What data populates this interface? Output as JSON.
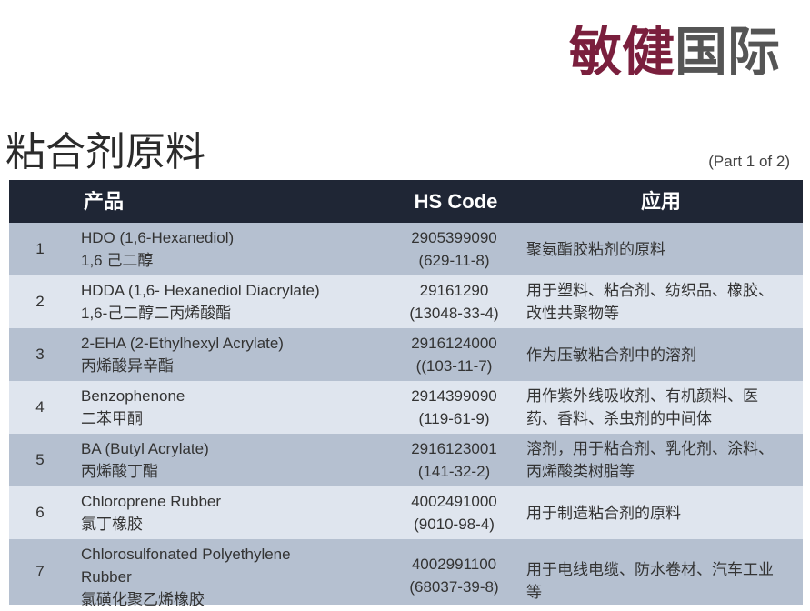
{
  "brand": {
    "part1": "敏健",
    "part2": "国际"
  },
  "title": "粘合剂原料",
  "part_label": "(Part 1 of 2)",
  "table": {
    "headers": {
      "product": "产品",
      "hs_code": "HS Code",
      "application": "应用"
    },
    "rows": [
      {
        "num": "1",
        "name_en": "HDO (1,6-Hexanediol)",
        "name_cn": "1,6 己二醇",
        "hs": "2905399090",
        "cas": "(629-11-8)",
        "use1": "聚氨酯胶粘剂的原料",
        "use2": ""
      },
      {
        "num": "2",
        "name_en": "HDDA (1,6- Hexanediol Diacrylate)",
        "name_cn": "1,6-己二醇二丙烯酸酯",
        "hs": "29161290",
        "cas": "(13048-33-4)",
        "use1": "用于塑料、粘合剂、纺织品、橡胶、",
        "use2": "改性共聚物等"
      },
      {
        "num": "3",
        "name_en": "2-EHA (2-Ethylhexyl Acrylate)",
        "name_cn": "丙烯酸异辛酯",
        "hs": "2916124000",
        "cas": "((103-11-7)",
        "use1": "作为压敏粘合剂中的溶剂",
        "use2": ""
      },
      {
        "num": "4",
        "name_en": "Benzophenone",
        "name_cn": "二苯甲酮",
        "hs": "2914399090",
        "cas": "(119-61-9)",
        "use1": "用作紫外线吸收剂、有机颜料、医",
        "use2": "药、香料、杀虫剂的中间体"
      },
      {
        "num": "5",
        "name_en": "BA (Butyl Acrylate)",
        "name_cn": "丙烯酸丁酯",
        "hs": "2916123001",
        "cas": "(141-32-2)",
        "use1": "溶剂，用于粘合剂、乳化剂、涂料、",
        "use2": "丙烯酸类树脂等"
      },
      {
        "num": "6",
        "name_en": "Chloroprene Rubber",
        "name_cn": "氯丁橡胶",
        "hs": "4002491000",
        "cas": "(9010-98-4)",
        "use1": "用于制造粘合剂的原料",
        "use2": ""
      },
      {
        "num": "7",
        "name_en": "Chlorosulfonated Polyethylene",
        "name_en2": "Rubber",
        "name_cn": "氯磺化聚乙烯橡胶",
        "hs": "4002991100",
        "cas": "(68037-39-8)",
        "use1": "用于电线电缆、防水卷材、汽车工业",
        "use2": "等"
      }
    ]
  }
}
